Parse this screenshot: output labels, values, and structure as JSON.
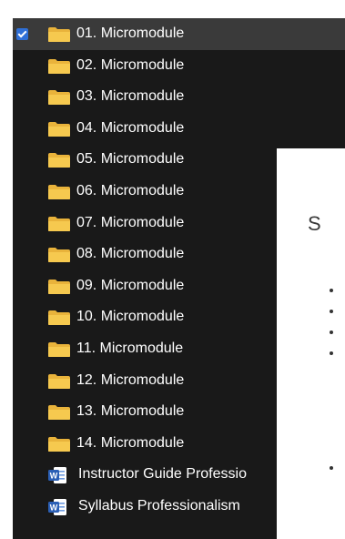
{
  "explorer": {
    "items": [
      {
        "label": "01. Micromodule",
        "type": "folder",
        "selected": true
      },
      {
        "label": "02. Micromodule",
        "type": "folder"
      },
      {
        "label": "03. Micromodule",
        "type": "folder"
      },
      {
        "label": "04. Micromodule",
        "type": "folder"
      },
      {
        "label": "05. Micromodule",
        "type": "folder"
      },
      {
        "label": "06. Micromodule",
        "type": "folder"
      },
      {
        "label": "07. Micromodule",
        "type": "folder"
      },
      {
        "label": "08. Micromodule",
        "type": "folder"
      },
      {
        "label": "09. Micromodule",
        "type": "folder"
      },
      {
        "label": "10. Micromodule",
        "type": "folder"
      },
      {
        "label": "11. Micromodule",
        "type": "folder"
      },
      {
        "label": "12. Micromodule",
        "type": "folder"
      },
      {
        "label": "13. Micromodule",
        "type": "folder"
      },
      {
        "label": "14. Micromodule",
        "type": "folder"
      },
      {
        "label": "Instructor Guide Professio",
        "type": "word-doc"
      },
      {
        "label": "Syllabus Professionalism",
        "type": "word-doc"
      }
    ]
  },
  "overlay": {
    "title_fragment": "S"
  },
  "colors": {
    "explorer_bg": "#191919",
    "selected_bg": "#3a3a3a",
    "folder": "#f3c34a",
    "checkbox": "#2f6fd6",
    "word_blue": "#2b5fb5"
  }
}
